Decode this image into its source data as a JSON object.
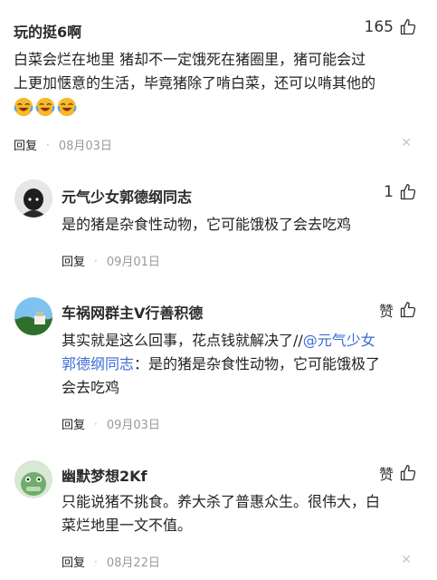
{
  "top_comment": {
    "username": "玩的挺6啊",
    "likes": "165",
    "text_line1": "白菜会烂在地里 猪却不一定饿死在猪圈里，猪可能会过",
    "text_line2": "上更加惬意的生活，毕竟猪除了啃白菜，还可以啃其他的",
    "emoji_count": 3,
    "reply_label": "回复",
    "date": "08月03日"
  },
  "replies": [
    {
      "username": "元气少女郭德纲同志",
      "likes": "1",
      "lines": [
        "是的猪是杂食性动物，它可能饿极了会去吃鸡"
      ],
      "reply_label": "回复",
      "date": "09月01日"
    },
    {
      "username": "车祸网群主V行善积德",
      "likes": "赞",
      "line1_prefix": "其实就是这么回事，花点钱就解决了//",
      "mention_part1": "@元气少女",
      "mention_part2": "郭德纲同志",
      "line2_suffix": "：是的猪是杂食性动物，它可能饿极了",
      "line3": "会去吃鸡",
      "reply_label": "回复",
      "date": "09月03日"
    },
    {
      "username": "幽默梦想2Kf",
      "likes": "赞",
      "lines": [
        "只能说猪不挑食。养大杀了普惠众生。很伟大，白",
        "菜烂地里一文不值。"
      ],
      "reply_label": "回复",
      "date": "08月22日"
    }
  ],
  "icons": {
    "like": "thumbs-up-icon",
    "close": "close-icon",
    "emoji": "laughing-crying-emoji"
  },
  "colors": {
    "mention": "#3b6bd6",
    "date": "#9a9a9a"
  }
}
